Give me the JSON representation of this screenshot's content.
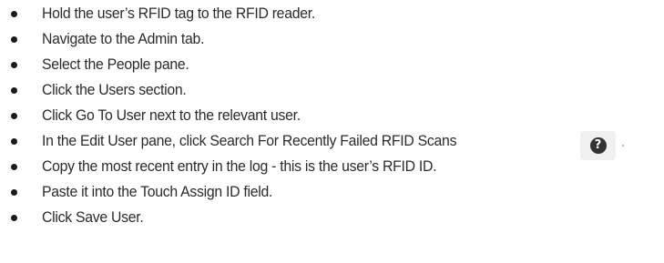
{
  "steps": [
    "Hold the user’s RFID tag to the RFID reader.",
    "Navigate to the Admin tab.",
    "Select the People pane.",
    "Click the Users section.",
    "Click Go To User next to the relevant user.",
    "In the Edit User pane, click Search For Recently Failed RFID Scans",
    "Copy the most recent entry in the log - this is the user’s RFID ID.",
    "Paste it into the Touch Assign ID field.",
    "Click Save User."
  ],
  "help_button": {
    "icon": "question-circle-icon",
    "glyph": "?"
  }
}
